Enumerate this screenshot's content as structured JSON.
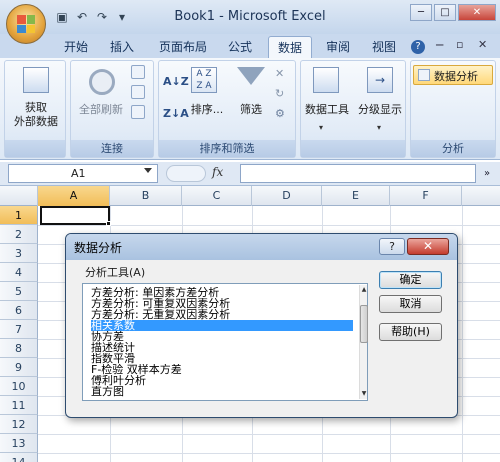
{
  "window": {
    "title": "Book1 - Microsoft Excel",
    "minimize_icon": "minimize-icon",
    "maximize_icon": "maximize-icon",
    "close_icon": "close-icon"
  },
  "quick_access": [
    "save-icon",
    "undo-icon",
    "redo-icon",
    "customize-icon"
  ],
  "tabs": [
    "开始",
    "插入",
    "页面布局",
    "公式",
    "数据",
    "审阅",
    "视图"
  ],
  "active_tab": "数据",
  "ribbon": {
    "groups": [
      {
        "label": ""
      },
      {
        "label": "连接"
      },
      {
        "label": "排序和筛选"
      },
      {
        "label": ""
      },
      {
        "label": "分析"
      }
    ],
    "get_external_line1": "获取",
    "get_external_line2": "外部数据",
    "refresh_all": "全部刷新",
    "sort": "排序...",
    "filter": "筛选",
    "data_tools": "数据工具",
    "outline": "分级显示",
    "data_analysis": "数据分析"
  },
  "formula_bar": {
    "name_box": "A1",
    "fx": "fx",
    "formula": ""
  },
  "grid": {
    "columns": [
      "A",
      "B",
      "C",
      "D",
      "E",
      "F"
    ],
    "rows": [
      "1",
      "2",
      "3",
      "4",
      "5",
      "6",
      "7",
      "8",
      "9",
      "10",
      "11",
      "12",
      "13",
      "14"
    ],
    "selected_cell": "A1"
  },
  "dialog": {
    "title": "数据分析",
    "help_label": "?",
    "close_label": "✕",
    "tools_label": "分析工具(A)",
    "tools": [
      "方差分析: 单因素方差分析",
      "方差分析: 可重复双因素分析",
      "方差分析: 无重复双因素分析",
      "相关系数",
      "协方差",
      "描述统计",
      "指数平滑",
      "F-检验 双样本方差",
      "傅利叶分析",
      "直方图"
    ],
    "selected_tool": "相关系数",
    "ok": "确定",
    "cancel": "取消",
    "help": "帮助(H)"
  },
  "colors": {
    "accent": "#c9d9ee",
    "selected_header": "#f1bd58",
    "selection": "#3399ff"
  }
}
